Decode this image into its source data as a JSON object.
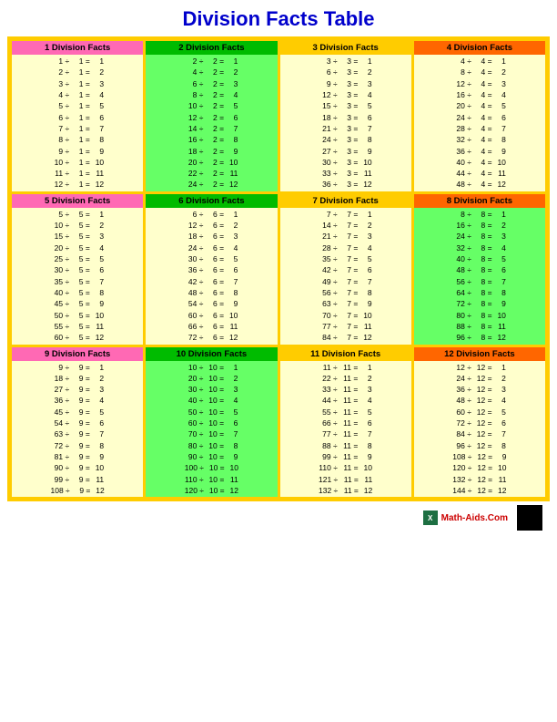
{
  "title": "Division Facts Table",
  "footer": {
    "site": "Math-Aids.Com"
  },
  "sections": [
    {
      "id": "s1",
      "label": "1 Division Facts",
      "divisor": 1,
      "rows": [
        [
          1,
          1,
          1
        ],
        [
          2,
          1,
          2
        ],
        [
          3,
          1,
          3
        ],
        [
          4,
          1,
          4
        ],
        [
          5,
          1,
          5
        ],
        [
          6,
          1,
          6
        ],
        [
          7,
          1,
          7
        ],
        [
          8,
          1,
          8
        ],
        [
          9,
          1,
          9
        ],
        [
          10,
          1,
          10
        ],
        [
          11,
          1,
          11
        ],
        [
          12,
          1,
          12
        ]
      ]
    },
    {
      "id": "s2",
      "label": "2 Division Facts",
      "divisor": 2,
      "rows": [
        [
          2,
          2,
          1
        ],
        [
          4,
          2,
          2
        ],
        [
          6,
          2,
          3
        ],
        [
          8,
          2,
          4
        ],
        [
          10,
          2,
          5
        ],
        [
          12,
          2,
          6
        ],
        [
          14,
          2,
          7
        ],
        [
          16,
          2,
          8
        ],
        [
          18,
          2,
          9
        ],
        [
          20,
          2,
          10
        ],
        [
          22,
          2,
          11
        ],
        [
          24,
          2,
          12
        ]
      ]
    },
    {
      "id": "s3",
      "label": "3 Division Facts",
      "divisor": 3,
      "rows": [
        [
          3,
          3,
          1
        ],
        [
          6,
          3,
          2
        ],
        [
          9,
          3,
          3
        ],
        [
          12,
          3,
          4
        ],
        [
          15,
          3,
          5
        ],
        [
          18,
          3,
          6
        ],
        [
          21,
          3,
          7
        ],
        [
          24,
          3,
          8
        ],
        [
          27,
          3,
          9
        ],
        [
          30,
          3,
          10
        ],
        [
          33,
          3,
          11
        ],
        [
          36,
          3,
          12
        ]
      ]
    },
    {
      "id": "s4",
      "label": "4 Division Facts",
      "divisor": 4,
      "rows": [
        [
          4,
          4,
          1
        ],
        [
          8,
          4,
          2
        ],
        [
          12,
          4,
          3
        ],
        [
          16,
          4,
          4
        ],
        [
          20,
          4,
          5
        ],
        [
          24,
          4,
          6
        ],
        [
          28,
          4,
          7
        ],
        [
          32,
          4,
          8
        ],
        [
          36,
          4,
          9
        ],
        [
          40,
          4,
          10
        ],
        [
          44,
          4,
          11
        ],
        [
          48,
          4,
          12
        ]
      ]
    },
    {
      "id": "s5",
      "label": "5 Division Facts",
      "divisor": 5,
      "rows": [
        [
          5,
          5,
          1
        ],
        [
          10,
          5,
          2
        ],
        [
          15,
          5,
          3
        ],
        [
          20,
          5,
          4
        ],
        [
          25,
          5,
          5
        ],
        [
          30,
          5,
          6
        ],
        [
          35,
          5,
          7
        ],
        [
          40,
          5,
          8
        ],
        [
          45,
          5,
          9
        ],
        [
          50,
          5,
          10
        ],
        [
          55,
          5,
          11
        ],
        [
          60,
          5,
          12
        ]
      ]
    },
    {
      "id": "s6",
      "label": "6 Division Facts",
      "divisor": 6,
      "rows": [
        [
          6,
          6,
          1
        ],
        [
          12,
          6,
          2
        ],
        [
          18,
          6,
          3
        ],
        [
          24,
          6,
          4
        ],
        [
          30,
          6,
          5
        ],
        [
          36,
          6,
          6
        ],
        [
          42,
          6,
          7
        ],
        [
          48,
          6,
          8
        ],
        [
          54,
          6,
          9
        ],
        [
          60,
          6,
          10
        ],
        [
          66,
          6,
          11
        ],
        [
          72,
          6,
          12
        ]
      ]
    },
    {
      "id": "s7",
      "label": "7 Division Facts",
      "divisor": 7,
      "rows": [
        [
          7,
          7,
          1
        ],
        [
          14,
          7,
          2
        ],
        [
          21,
          7,
          3
        ],
        [
          28,
          7,
          4
        ],
        [
          35,
          7,
          5
        ],
        [
          42,
          7,
          6
        ],
        [
          49,
          7,
          7
        ],
        [
          56,
          7,
          8
        ],
        [
          63,
          7,
          9
        ],
        [
          70,
          7,
          10
        ],
        [
          77,
          7,
          11
        ],
        [
          84,
          7,
          12
        ]
      ]
    },
    {
      "id": "s8",
      "label": "8 Division Facts",
      "divisor": 8,
      "rows": [
        [
          8,
          8,
          1
        ],
        [
          16,
          8,
          2
        ],
        [
          24,
          8,
          3
        ],
        [
          32,
          8,
          4
        ],
        [
          40,
          8,
          5
        ],
        [
          48,
          8,
          6
        ],
        [
          56,
          8,
          7
        ],
        [
          64,
          8,
          8
        ],
        [
          72,
          8,
          9
        ],
        [
          80,
          8,
          10
        ],
        [
          88,
          8,
          11
        ],
        [
          96,
          8,
          12
        ]
      ]
    },
    {
      "id": "s9",
      "label": "9 Division Facts",
      "divisor": 9,
      "rows": [
        [
          9,
          9,
          1
        ],
        [
          18,
          9,
          2
        ],
        [
          27,
          9,
          3
        ],
        [
          36,
          9,
          4
        ],
        [
          45,
          9,
          5
        ],
        [
          54,
          9,
          6
        ],
        [
          63,
          9,
          7
        ],
        [
          72,
          9,
          8
        ],
        [
          81,
          9,
          9
        ],
        [
          90,
          9,
          10
        ],
        [
          99,
          9,
          11
        ],
        [
          108,
          9,
          12
        ]
      ]
    },
    {
      "id": "s10",
      "label": "10 Division Facts",
      "divisor": 10,
      "rows": [
        [
          10,
          10,
          1
        ],
        [
          20,
          10,
          2
        ],
        [
          30,
          10,
          3
        ],
        [
          40,
          10,
          4
        ],
        [
          50,
          10,
          5
        ],
        [
          60,
          10,
          6
        ],
        [
          70,
          10,
          7
        ],
        [
          80,
          10,
          8
        ],
        [
          90,
          10,
          9
        ],
        [
          100,
          10,
          10
        ],
        [
          110,
          10,
          11
        ],
        [
          120,
          10,
          12
        ]
      ]
    },
    {
      "id": "s11",
      "label": "11 Division Facts",
      "divisor": 11,
      "rows": [
        [
          11,
          11,
          1
        ],
        [
          22,
          11,
          2
        ],
        [
          33,
          11,
          3
        ],
        [
          44,
          11,
          4
        ],
        [
          55,
          11,
          5
        ],
        [
          66,
          11,
          6
        ],
        [
          77,
          11,
          7
        ],
        [
          88,
          11,
          8
        ],
        [
          99,
          11,
          9
        ],
        [
          110,
          11,
          10
        ],
        [
          121,
          11,
          11
        ],
        [
          132,
          11,
          12
        ]
      ]
    },
    {
      "id": "s12",
      "label": "12 Division Facts",
      "divisor": 12,
      "rows": [
        [
          12,
          12,
          1
        ],
        [
          24,
          12,
          2
        ],
        [
          36,
          12,
          3
        ],
        [
          48,
          12,
          4
        ],
        [
          60,
          12,
          5
        ],
        [
          72,
          12,
          6
        ],
        [
          84,
          12,
          7
        ],
        [
          96,
          12,
          8
        ],
        [
          108,
          12,
          9
        ],
        [
          120,
          12,
          10
        ],
        [
          132,
          12,
          11
        ],
        [
          144,
          12,
          12
        ]
      ]
    }
  ]
}
